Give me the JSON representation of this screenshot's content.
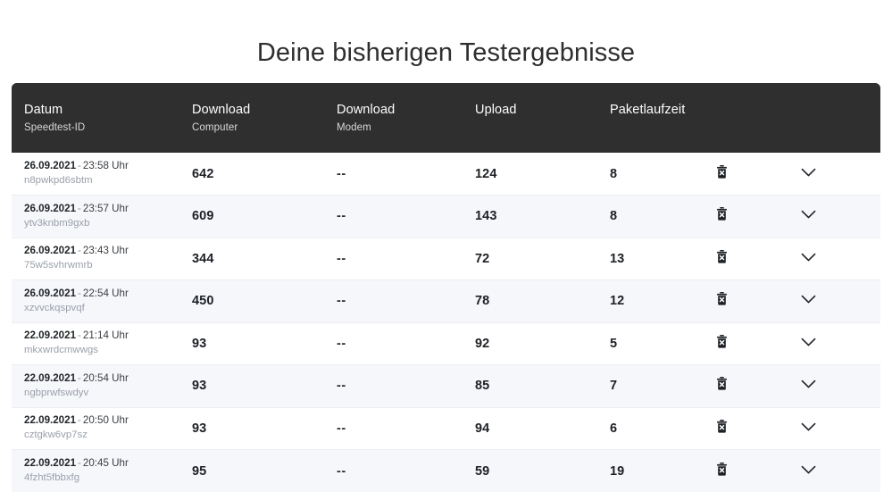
{
  "page": {
    "title": "Deine bisherigen Testergebnisse"
  },
  "table": {
    "columns": [
      {
        "main": "Datum",
        "sub": "Speedtest-ID"
      },
      {
        "main": "Download",
        "sub": "Computer"
      },
      {
        "main": "Download",
        "sub": "Modem"
      },
      {
        "main": "Upload",
        "sub": ""
      },
      {
        "main": "Paketlaufzeit",
        "sub": ""
      },
      {
        "main": "",
        "sub": ""
      },
      {
        "main": "",
        "sub": ""
      }
    ],
    "icons": {
      "delete": "trash-icon",
      "expand": "chevron-down-icon"
    },
    "rows": [
      {
        "date": "26.09.2021",
        "separator": "-",
        "time": "23:58 Uhr",
        "id": "n8pwkpd6sbtm",
        "download_computer": "642",
        "download_modem": "--",
        "upload": "124",
        "latency": "8"
      },
      {
        "date": "26.09.2021",
        "separator": "-",
        "time": "23:57 Uhr",
        "id": "ytv3knbm9gxb",
        "download_computer": "609",
        "download_modem": "--",
        "upload": "143",
        "latency": "8"
      },
      {
        "date": "26.09.2021",
        "separator": "-",
        "time": "23:43 Uhr",
        "id": "75w5svhrwmrb",
        "download_computer": "344",
        "download_modem": "--",
        "upload": "72",
        "latency": "13"
      },
      {
        "date": "26.09.2021",
        "separator": "-",
        "time": "22:54 Uhr",
        "id": "xzvvckqspvqf",
        "download_computer": "450",
        "download_modem": "--",
        "upload": "78",
        "latency": "12"
      },
      {
        "date": "22.09.2021",
        "separator": "-",
        "time": "21:14 Uhr",
        "id": "mkxwrdcmwwgs",
        "download_computer": "93",
        "download_modem": "--",
        "upload": "92",
        "latency": "5"
      },
      {
        "date": "22.09.2021",
        "separator": "-",
        "time": "20:54 Uhr",
        "id": "ngbprwfswdyv",
        "download_computer": "93",
        "download_modem": "--",
        "upload": "85",
        "latency": "7"
      },
      {
        "date": "22.09.2021",
        "separator": "-",
        "time": "20:50 Uhr",
        "id": "cztgkw6vp7sz",
        "download_computer": "93",
        "download_modem": "--",
        "upload": "94",
        "latency": "6"
      },
      {
        "date": "22.09.2021",
        "separator": "-",
        "time": "20:45 Uhr",
        "id": "4fzht5fbbxfg",
        "download_computer": "95",
        "download_modem": "--",
        "upload": "59",
        "latency": "19"
      }
    ]
  },
  "colors": {
    "header_background": "#2f2f2f",
    "row_alt_background": "#f6f7fb",
    "page_background": "#ffffff",
    "text_primary": "#212529",
    "text_muted": "#9aa0aa"
  }
}
